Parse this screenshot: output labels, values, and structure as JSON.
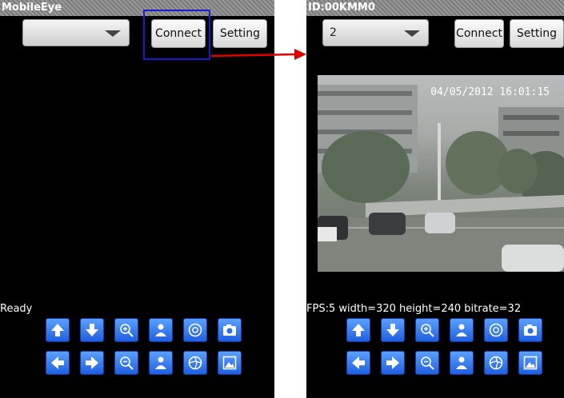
{
  "left_screen": {
    "title": "MobileEye",
    "spinner_value": "",
    "connect_label": "Connect",
    "setting_label": "Setting",
    "status": "Ready"
  },
  "right_screen": {
    "title": "ID:00KMM0",
    "spinner_value": "2",
    "connect_label": "Connect",
    "setting_label": "Setting",
    "status": "FPS:5 width=320 height=240 bitrate=32",
    "video_timestamp": "04/05/2012 16:01:15"
  },
  "controls_row1": [
    "arrow-up-icon",
    "arrow-down-icon",
    "zoom-in-icon",
    "person-icon",
    "iris-open-icon",
    "camera-icon"
  ],
  "controls_row2": [
    "arrow-left-icon",
    "arrow-right-icon",
    "zoom-out-icon",
    "person-icon",
    "iris-close-icon",
    "picture-icon"
  ],
  "colors": {
    "highlight": "#1a1ad6",
    "annotation_arrow": "#e00000",
    "control_button": "#2f74f0"
  }
}
